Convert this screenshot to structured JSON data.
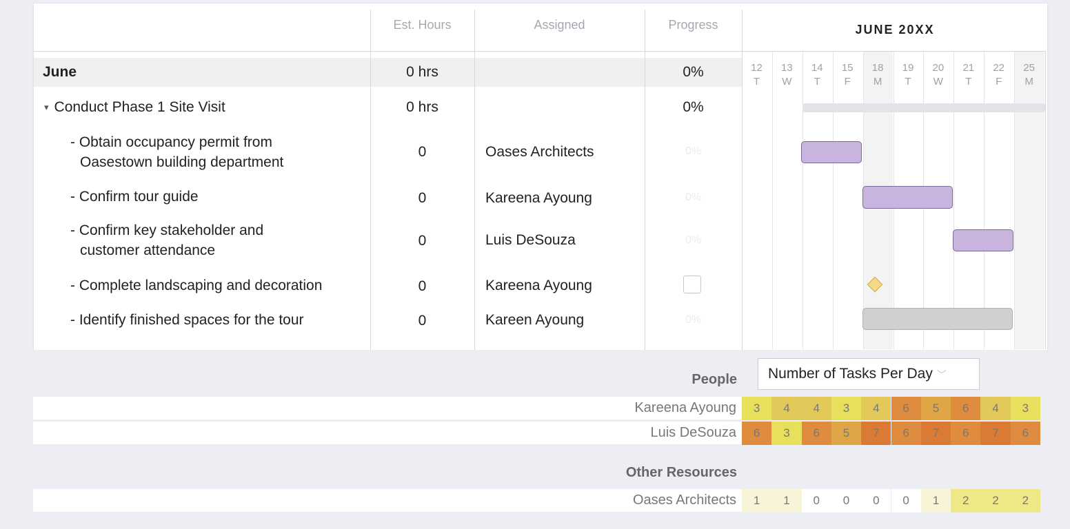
{
  "headers": {
    "est_hours": "Est. Hours",
    "assigned": "Assigned",
    "progress": "Progress",
    "gantt_title": "JUNE 20XX"
  },
  "days": [
    {
      "num": "12",
      "dow": "T"
    },
    {
      "num": "13",
      "dow": "W"
    },
    {
      "num": "14",
      "dow": "T"
    },
    {
      "num": "15",
      "dow": "F"
    },
    {
      "num": "18",
      "dow": "M"
    },
    {
      "num": "19",
      "dow": "T"
    },
    {
      "num": "20",
      "dow": "W"
    },
    {
      "num": "21",
      "dow": "T"
    },
    {
      "num": "22",
      "dow": "F"
    },
    {
      "num": "25",
      "dow": "M"
    }
  ],
  "rows": [
    {
      "name": "June",
      "hours": "0 hrs",
      "assigned": "",
      "progress": "0%"
    },
    {
      "name": "Conduct Phase 1 Site Visit",
      "hours": "0 hrs",
      "assigned": "",
      "progress": "0%",
      "toggle": "▾"
    },
    {
      "name_line1": "- Obtain occupancy permit from",
      "name_line2": "Oasestown building department",
      "hours": "0",
      "assigned": "Oases Architects",
      "progress": "0%"
    },
    {
      "name": "- Confirm tour guide",
      "hours": "0",
      "assigned": "Kareena Ayoung",
      "progress": "0%"
    },
    {
      "name_line1": "- Confirm key stakeholder and",
      "name_line2": "customer attendance",
      "hours": "0",
      "assigned": "Luis DeSouza",
      "progress": "0%"
    },
    {
      "name": "- Complete landscaping and decoration",
      "hours": "0",
      "assigned": "Kareena Ayoung",
      "progress": ""
    },
    {
      "name": "- Identify finished spaces for the tour",
      "hours": "0",
      "assigned": "Kareen Ayoung",
      "progress": "0%"
    }
  ],
  "resources": {
    "people_heading": "People",
    "dropdown_value": "Number of Tasks Per Day",
    "people": [
      {
        "name": "Kareena Ayoung",
        "values": [
          "3",
          "4",
          "4",
          "3",
          "4",
          "6",
          "5",
          "6",
          "4",
          "3"
        ]
      },
      {
        "name": "Luis DeSouza",
        "values": [
          "6",
          "3",
          "6",
          "5",
          "7",
          "6",
          "7",
          "6",
          "7",
          "6"
        ]
      }
    ],
    "other_heading": "Other Resources",
    "other": [
      {
        "name": "Oases Architects",
        "values": [
          "1",
          "1",
          "0",
          "0",
          "0",
          "0",
          "1",
          "2",
          "2",
          "2"
        ]
      }
    ]
  },
  "colors": {
    "bar_purple": "#c9b3df",
    "bar_gray": "#d0d0d0",
    "milestone": "#f5d889",
    "heat_3": "#e8df5c",
    "heat_4": "#e3c95a",
    "heat_5": "#e0a545",
    "heat_6": "#e08c3e",
    "heat_7": "#db7a35",
    "heat_0": "#ffffff",
    "heat_1": "#f7f4d8",
    "heat_2": "#eee886"
  }
}
